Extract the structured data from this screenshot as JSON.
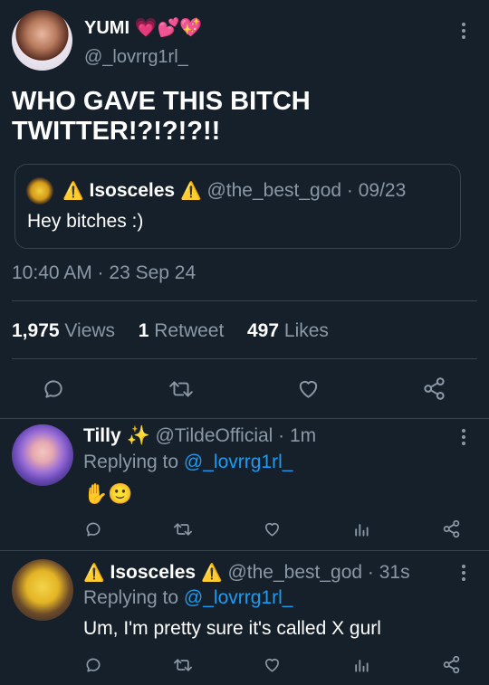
{
  "main_tweet": {
    "display_name": "YUMI 💗💕💖",
    "handle": "@_lovrrg1rl_",
    "text": "WHO GAVE THIS BITCH TWITTER!?!?!?!!",
    "timestamp": "10:40 AM · 23 Sep 24",
    "stats": {
      "views_count": "1,975",
      "views_label": "Views",
      "retweets_count": "1",
      "retweets_label": "Retweet",
      "likes_count": "497",
      "likes_label": "Likes"
    }
  },
  "quoted_tweet": {
    "display_name": "Isosceles",
    "warning_emoji": "⚠️",
    "handle_time": "@the_best_god · 09/23",
    "text": "Hey bitches :)"
  },
  "replies": [
    {
      "display_name": "Tilly ✨",
      "handle_time": "@TildeOfficial · 1m",
      "replying_prefix": "Replying to",
      "replying_to": "@_lovrrg1rl_",
      "text": "✋🙂"
    },
    {
      "display_name": "Isosceles",
      "warning_emoji": "⚠️",
      "handle_time": "@the_best_god · 31s",
      "replying_prefix": "Replying to",
      "replying_to": "@_lovrrg1rl_",
      "text": "Um, I'm pretty sure it's called X gurl"
    }
  ],
  "icons": [
    "reply-icon",
    "retweet-icon",
    "like-icon",
    "share-icon",
    "views-icon",
    "more-icon"
  ],
  "colors": {
    "background": "#15202b",
    "muted": "#8b98a5",
    "link": "#1d9bf0",
    "divider": "#38444d"
  }
}
